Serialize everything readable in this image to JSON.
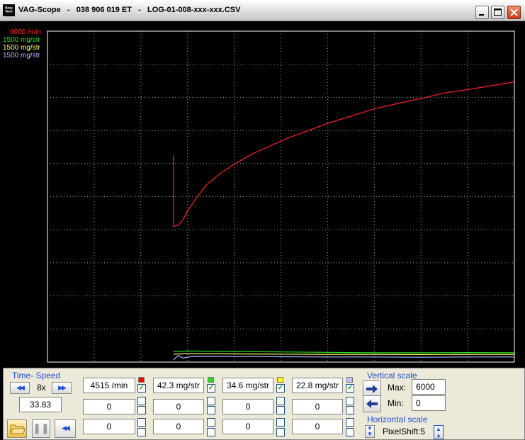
{
  "window": {
    "app_icon": "Ross Tech",
    "title": "VAG-Scope   -   038 906 019 ET   -   LOG-01-008-xxx-xxx.CSV"
  },
  "scope": {
    "scale_labels": [
      {
        "text": "6000 /min",
        "color": "#ff2020"
      },
      {
        "text": "1500 mg/str",
        "color": "#22dd22"
      },
      {
        "text": "1500 mg/str",
        "color": "#ffff60"
      },
      {
        "text": "1500 mg/str",
        "color": "#b0b8ff"
      }
    ]
  },
  "chart_data": {
    "type": "line",
    "title": "",
    "xlabel": "",
    "ylabel": "",
    "x_divisions": 10,
    "y_divisions": 10,
    "grid": true,
    "series": [
      {
        "color": "#ff2020",
        "unit": "/min",
        "scale_max": 6000,
        "x": [
          0.27,
          0.27,
          0.28,
          0.29,
          0.3,
          0.32,
          0.34,
          0.37,
          0.4,
          0.44,
          0.48,
          0.52,
          0.56,
          0.6,
          0.65,
          0.7,
          0.75,
          0.8,
          0.85,
          0.9,
          0.95,
          1.0
        ],
        "values": [
          3750,
          2460,
          2480,
          2580,
          2740,
          2990,
          3210,
          3420,
          3590,
          3780,
          3930,
          4080,
          4200,
          4330,
          4460,
          4590,
          4690,
          4780,
          4880,
          4940,
          5010,
          5080
        ]
      },
      {
        "color": "#22dd22",
        "unit": "mg/str",
        "scale_max": 1500,
        "x": [
          0.27,
          0.3,
          0.4,
          0.5,
          0.6,
          0.7,
          0.8,
          0.9,
          1.0
        ],
        "values": [
          48,
          50,
          48,
          46,
          44,
          42,
          42,
          43,
          42
        ]
      },
      {
        "color": "#ffff60",
        "unit": "mg/str",
        "scale_max": 1500,
        "x": [
          0.27,
          0.3,
          0.4,
          0.5,
          0.6,
          0.7,
          0.8,
          0.9,
          1.0
        ],
        "values": [
          36,
          38,
          37,
          36,
          35,
          35,
          34,
          35,
          35
        ]
      },
      {
        "color": "#b0b8ff",
        "unit": "mg/str",
        "scale_max": 1500,
        "x": [
          0.27,
          0.28,
          0.29,
          0.31,
          0.4,
          0.5,
          0.6,
          0.7,
          0.8,
          0.9,
          1.0
        ],
        "values": [
          10,
          30,
          18,
          26,
          25,
          24,
          23,
          23,
          22,
          23,
          23
        ]
      }
    ]
  },
  "controls": {
    "time_speed": {
      "title": "Time- Speed",
      "speed": "8x",
      "position": "33.83"
    },
    "channels": [
      {
        "value": "4515 /min",
        "color": "#ff0000",
        "min_value": "0",
        "max_value": "0",
        "checked": true
      },
      {
        "value": "42.3 mg/str",
        "color": "#22dd22",
        "min_value": "0",
        "max_value": "0",
        "checked": true
      },
      {
        "value": "34.6 mg/str",
        "color": "#ffff00",
        "min_value": "0",
        "max_value": "0",
        "checked": true
      },
      {
        "value": "22.8 mg/str",
        "color": "#b8c0ff",
        "min_value": "0",
        "max_value": "0",
        "checked": true
      }
    ],
    "vertical_scale": {
      "title": "Vertical scale",
      "max_label": "Max:",
      "max_value": "6000",
      "min_label": "Min:",
      "min_value": "0"
    },
    "horizontal_scale": {
      "title": "Horizontal scale",
      "label": "PixelShift:5"
    }
  }
}
